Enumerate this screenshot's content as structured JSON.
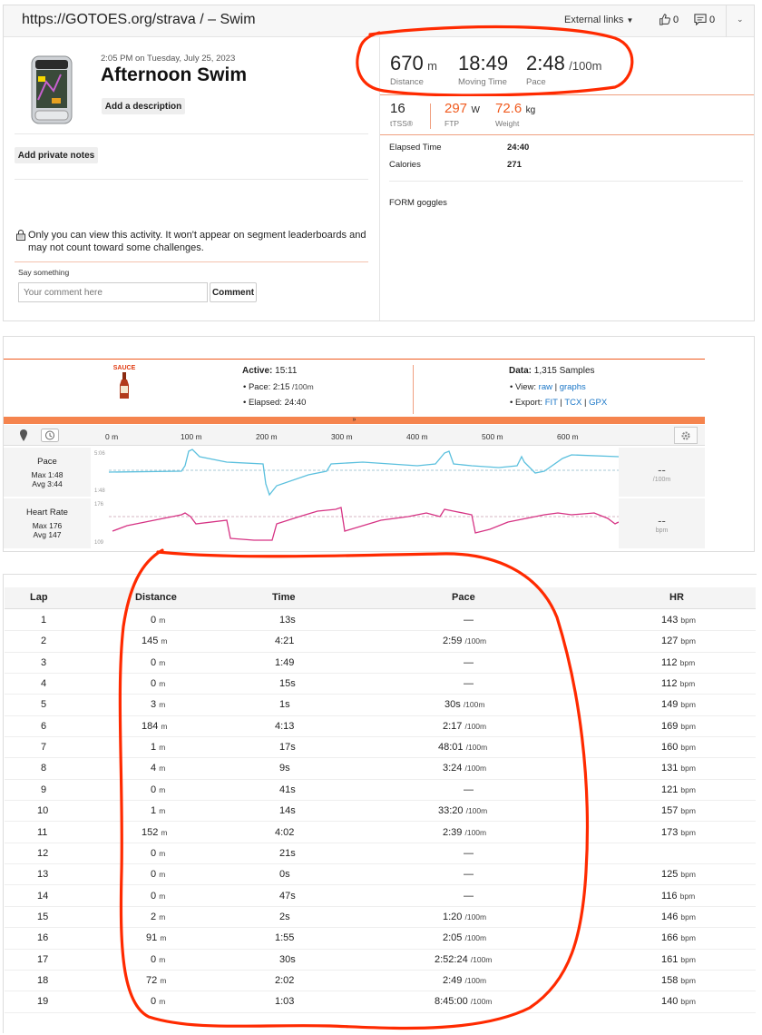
{
  "header": {
    "title": "https://GOTOES.org/strava / – Swim",
    "external_links": "External links",
    "kudos_count": "0",
    "comments_count": "0"
  },
  "activity": {
    "datetime": "2:05 PM on Tuesday, July 25, 2023",
    "name": "Afternoon Swim",
    "add_description": "Add a description",
    "add_private_notes": "Add private notes",
    "privacy_notice": "Only you can view this activity. It won't appear on segment leaderboards and may not count toward some challenges.",
    "say_something": "Say something",
    "comment_placeholder": "Your comment here",
    "comment_button": "Comment"
  },
  "stats": {
    "distance_value": "670",
    "distance_unit": "m",
    "distance_label": "Distance",
    "moving_time_value": "18:49",
    "moving_time_label": "Moving Time",
    "pace_value": "2:48",
    "pace_unit": "/100m",
    "pace_label": "Pace",
    "tss_value": "16",
    "tss_label": "tTSS®",
    "ftp_value": "297",
    "ftp_unit": "W",
    "ftp_label": "FTP",
    "weight_value": "72.6",
    "weight_unit": "kg",
    "weight_label": "Weight",
    "elapsed_label": "Elapsed Time",
    "elapsed_value": "24:40",
    "calories_label": "Calories",
    "calories_value": "271",
    "gear": "FORM goggles"
  },
  "sauce": {
    "logo_text": "SAUCE",
    "active_label": "Active:",
    "active_value": "15:11",
    "pace_line": "• Pace: 2:15",
    "pace_unit": "/100m",
    "elapsed_line": "• Elapsed: 24:40",
    "data_label": "Data:",
    "data_value": "1,315 Samples",
    "view_label": "• View:",
    "view_raw": "raw",
    "view_graphs": "graphs",
    "export_label": "• Export:",
    "export_fit": "FIT",
    "export_tcx": "TCX",
    "export_gpx": "GPX",
    "sep": "|",
    "distance_ticks": [
      "0 m",
      "100 m",
      "200 m",
      "300 m",
      "400 m",
      "500 m",
      "600 m"
    ],
    "pace_chart": {
      "label": "Pace",
      "max": "Max 1:48",
      "avg": "Avg 3:44",
      "y_top": "5:06",
      "y_bottom": "1:48",
      "readout": "--",
      "readout_unit": "/100m",
      "color": "#5bc0de"
    },
    "hr_chart": {
      "label": "Heart Rate",
      "max": "Max 176",
      "avg": "Avg 147",
      "y_top": "176",
      "y_bottom": "109",
      "readout": "--",
      "readout_unit": "bpm",
      "color": "#d63384"
    }
  },
  "laps": {
    "headers": [
      "Lap",
      "Distance",
      "Time",
      "Pace",
      "HR"
    ],
    "rows": [
      {
        "lap": "1",
        "dist": "0",
        "dunit": "m",
        "time": "13s",
        "pace": "—",
        "punit": "",
        "hr": "143",
        "hunit": "bpm"
      },
      {
        "lap": "2",
        "dist": "145",
        "dunit": "m",
        "time": "4:21",
        "pace": "2:59",
        "punit": "/100m",
        "hr": "127",
        "hunit": "bpm"
      },
      {
        "lap": "3",
        "dist": "0",
        "dunit": "m",
        "time": "1:49",
        "pace": "—",
        "punit": "",
        "hr": "112",
        "hunit": "bpm"
      },
      {
        "lap": "4",
        "dist": "0",
        "dunit": "m",
        "time": "15s",
        "pace": "—",
        "punit": "",
        "hr": "112",
        "hunit": "bpm"
      },
      {
        "lap": "5",
        "dist": "3",
        "dunit": "m",
        "time": "1s",
        "pace": "30s",
        "punit": "/100m",
        "hr": "149",
        "hunit": "bpm"
      },
      {
        "lap": "6",
        "dist": "184",
        "dunit": "m",
        "time": "4:13",
        "pace": "2:17",
        "punit": "/100m",
        "hr": "169",
        "hunit": "bpm"
      },
      {
        "lap": "7",
        "dist": "1",
        "dunit": "m",
        "time": "17s",
        "pace": "48:01",
        "punit": "/100m",
        "hr": "160",
        "hunit": "bpm"
      },
      {
        "lap": "8",
        "dist": "4",
        "dunit": "m",
        "time": "9s",
        "pace": "3:24",
        "punit": "/100m",
        "hr": "131",
        "hunit": "bpm"
      },
      {
        "lap": "9",
        "dist": "0",
        "dunit": "m",
        "time": "41s",
        "pace": "—",
        "punit": "",
        "hr": "121",
        "hunit": "bpm"
      },
      {
        "lap": "10",
        "dist": "1",
        "dunit": "m",
        "time": "14s",
        "pace": "33:20",
        "punit": "/100m",
        "hr": "157",
        "hunit": "bpm"
      },
      {
        "lap": "11",
        "dist": "152",
        "dunit": "m",
        "time": "4:02",
        "pace": "2:39",
        "punit": "/100m",
        "hr": "173",
        "hunit": "bpm"
      },
      {
        "lap": "12",
        "dist": "0",
        "dunit": "m",
        "time": "21s",
        "pace": "—",
        "punit": "",
        "hr": "",
        "hunit": ""
      },
      {
        "lap": "13",
        "dist": "0",
        "dunit": "m",
        "time": "0s",
        "pace": "—",
        "punit": "",
        "hr": "125",
        "hunit": "bpm"
      },
      {
        "lap": "14",
        "dist": "0",
        "dunit": "m",
        "time": "47s",
        "pace": "—",
        "punit": "",
        "hr": "116",
        "hunit": "bpm"
      },
      {
        "lap": "15",
        "dist": "2",
        "dunit": "m",
        "time": "2s",
        "pace": "1:20",
        "punit": "/100m",
        "hr": "146",
        "hunit": "bpm"
      },
      {
        "lap": "16",
        "dist": "91",
        "dunit": "m",
        "time": "1:55",
        "pace": "2:05",
        "punit": "/100m",
        "hr": "166",
        "hunit": "bpm"
      },
      {
        "lap": "17",
        "dist": "0",
        "dunit": "m",
        "time": "30s",
        "pace": "2:52:24",
        "punit": "/100m",
        "hr": "161",
        "hunit": "bpm"
      },
      {
        "lap": "18",
        "dist": "72",
        "dunit": "m",
        "time": "2:02",
        "pace": "2:49",
        "punit": "/100m",
        "hr": "158",
        "hunit": "bpm"
      },
      {
        "lap": "19",
        "dist": "0",
        "dunit": "m",
        "time": "1:03",
        "pace": "8:45:00",
        "punit": "/100m",
        "hr": "140",
        "hunit": "bpm"
      }
    ]
  },
  "colors": {
    "accent": "#f05a1e",
    "annotation": "#ff2a00",
    "link": "#1a76c7"
  }
}
